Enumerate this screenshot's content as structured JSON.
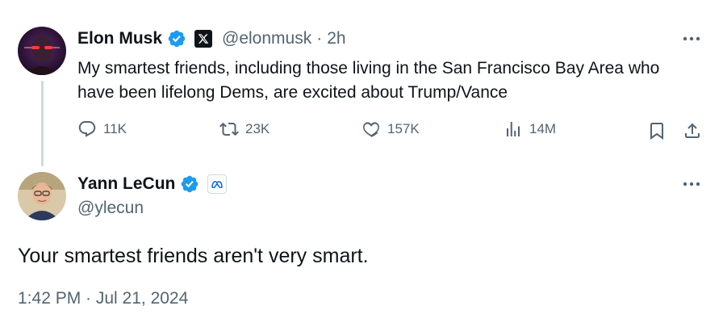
{
  "original_tweet": {
    "author_name": "Elon Musk",
    "handle": "@elonmusk",
    "separator": "·",
    "time_ago": "2h",
    "text": "My smartest friends, including those living in the San Francisco Bay Area who have been lifelong Dems, are excited about Trump/Vance",
    "stats": {
      "replies": "11K",
      "reposts": "23K",
      "likes": "157K",
      "views": "14M"
    },
    "icons": {
      "verified": "verified-badge-icon",
      "affiliate": "x-logo-icon",
      "more": "more-options-icon",
      "reply": "reply-icon",
      "repost": "repost-icon",
      "like": "heart-icon",
      "views": "views-icon",
      "bookmark": "bookmark-icon",
      "share": "share-icon"
    }
  },
  "reply_tweet": {
    "author_name": "Yann LeCun",
    "handle": "@ylecun",
    "text": "Your smartest friends aren't very smart.",
    "timestamp": "1:42 PM · Jul 21, 2024",
    "icons": {
      "verified": "verified-badge-icon",
      "affiliate": "meta-logo-icon",
      "more": "more-options-icon"
    }
  },
  "colors": {
    "verified_blue": "#1d9bf0",
    "text_primary": "#0f1419",
    "text_secondary": "#536471",
    "thread_line": "#cfd9de"
  }
}
